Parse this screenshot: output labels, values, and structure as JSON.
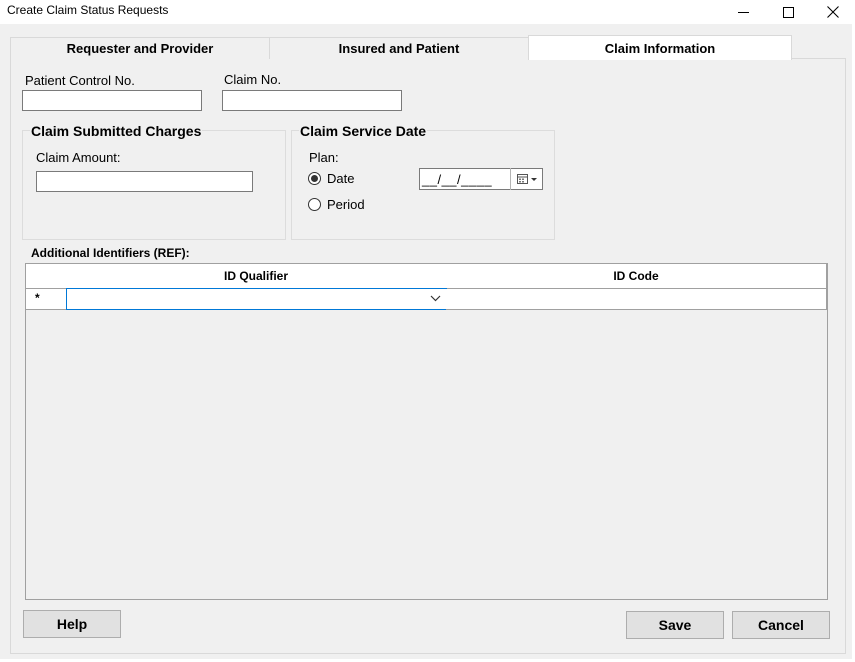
{
  "window": {
    "title": "Create Claim Status Requests",
    "controls": [
      "minimize-icon",
      "maximize-icon",
      "close-icon"
    ]
  },
  "tabs": [
    {
      "label": "Requester and Provider",
      "active": false
    },
    {
      "label": "Insured and Patient",
      "active": false
    },
    {
      "label": "Claim Information",
      "active": true
    }
  ],
  "claim": {
    "patient_control_label": "Patient Control No.",
    "patient_control_value": "",
    "claim_no_label": "Claim No.",
    "claim_no_value": ""
  },
  "charges": {
    "title": "Claim Submitted Charges",
    "amount_label": "Claim Amount:",
    "amount_value": ""
  },
  "service_date": {
    "title": "Claim Service Date",
    "plan_label": "Plan:",
    "options": [
      {
        "label": "Date",
        "selected": true
      },
      {
        "label": "Period",
        "selected": false
      }
    ],
    "date_mask": "__/__/____",
    "calendar_icon": "calendar-dropdown-icon"
  },
  "ref": {
    "label": "Additional Identifiers (REF):",
    "columns": [
      "ID Qualifier",
      "ID Code"
    ],
    "new_row_marker": "*",
    "rows": [
      {
        "id_qualifier": "",
        "id_code": ""
      }
    ]
  },
  "buttons": {
    "help": "Help",
    "save": "Save",
    "cancel": "Cancel"
  }
}
